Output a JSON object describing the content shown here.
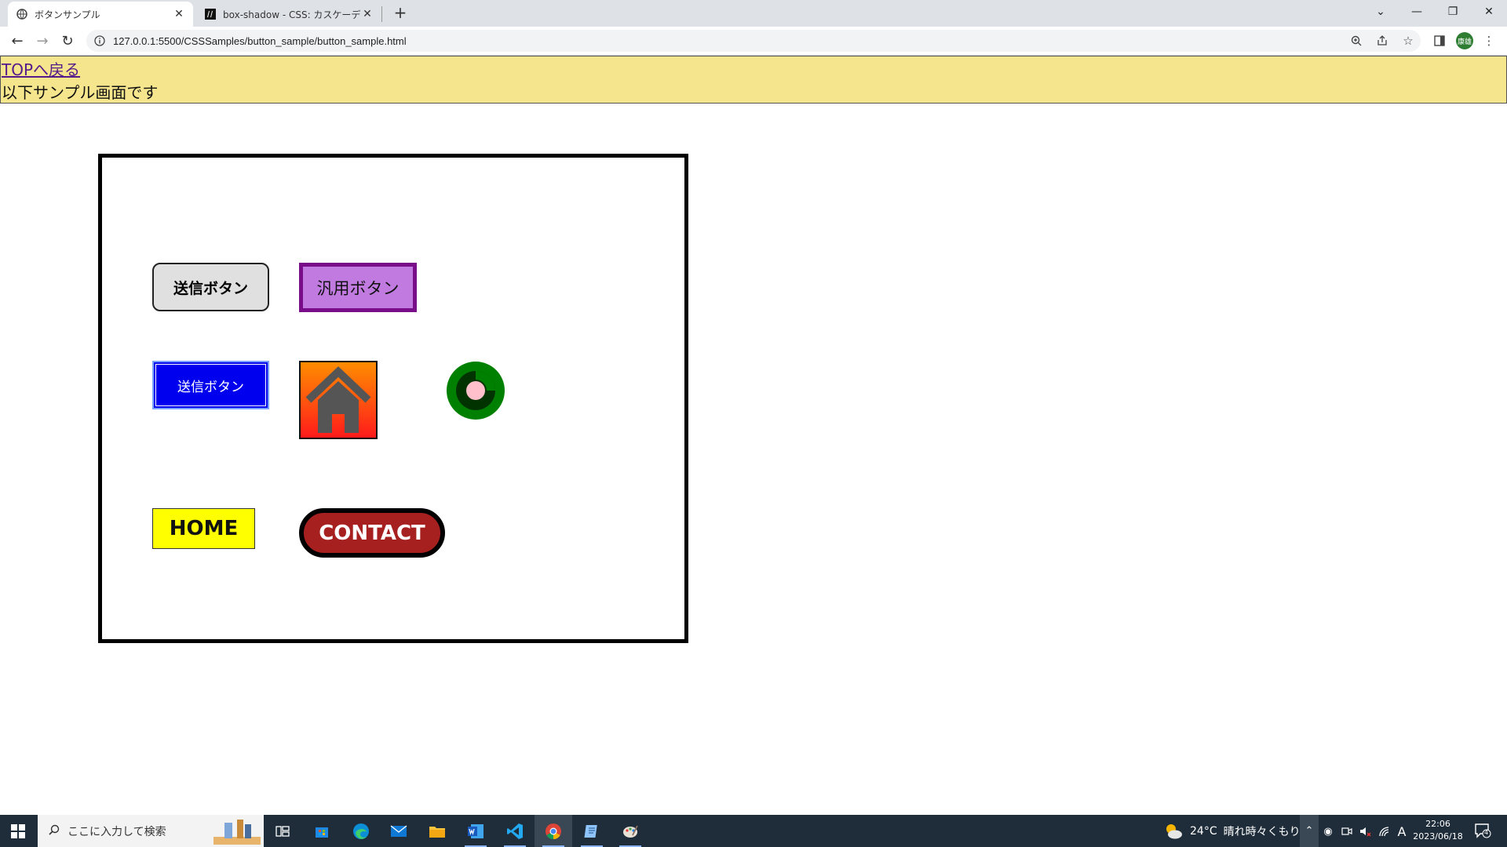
{
  "browser": {
    "tabs": [
      {
        "title": "ボタンサンプル",
        "active": true
      },
      {
        "title": "box-shadow - CSS: カスケーディング",
        "active": false
      }
    ],
    "new_tab": "+",
    "url": "127.0.0.1:5500/CSSSamples/button_sample/button_sample.html",
    "profile_label": "康雄"
  },
  "page": {
    "top_link": "TOPへ戻る",
    "subtitle": "以下サンプル画面です",
    "buttons": {
      "submit1": "送信ボタン",
      "general": "汎用ボタン",
      "submit2": "送信ボタン",
      "home": "HOME",
      "contact": "CONTACT"
    }
  },
  "taskbar": {
    "search_placeholder": "ここに入力して検索",
    "weather_temp": "24°C",
    "weather_text": "晴れ時々くもり",
    "time": "22:06",
    "date": "2023/06/18",
    "notifications": "4",
    "ime": "A"
  },
  "colors": {
    "header_bg": "#f5e58d",
    "general_button_bg": "#c07ae0",
    "submit2_bg": "#0000ee",
    "home_bg": "#ffff00",
    "contact_bg": "#a72020",
    "ring_outer": "#008000",
    "ring_center": "#ffc0cb"
  }
}
